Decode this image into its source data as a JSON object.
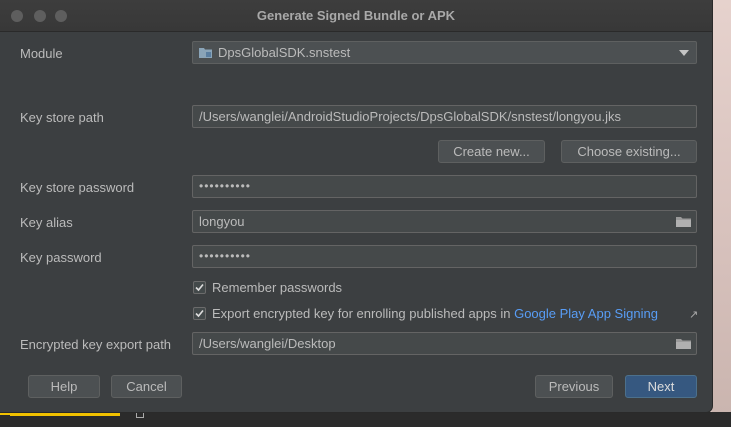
{
  "dialog": {
    "title": "Generate Signed Bundle or APK"
  },
  "module": {
    "label": "Module",
    "value": "DpsGlobalSDK.snstest"
  },
  "key_store_path": {
    "label": "Key store path",
    "value": "/Users/wanglei/AndroidStudioProjects/DpsGlobalSDK/snstest/longyou.jks"
  },
  "buttons": {
    "create_new": "Create new...",
    "choose_existing": "Choose existing...",
    "help": "Help",
    "cancel": "Cancel",
    "previous": "Previous",
    "next": "Next"
  },
  "key_store_password": {
    "label": "Key store password",
    "masked": "••••••••••"
  },
  "key_alias": {
    "label": "Key alias",
    "value": "longyou"
  },
  "key_password": {
    "label": "Key password",
    "masked": "••••••••••"
  },
  "remember_passwords": {
    "label": "Remember passwords",
    "checked": true
  },
  "export_encrypted": {
    "label": "Export encrypted key for enrolling published apps in",
    "link": "Google Play App Signing",
    "link_icon": "↗",
    "checked": true
  },
  "encrypted_export_path": {
    "label": "Encrypted key export path",
    "value": "/Users/wanglei/Desktop"
  },
  "colors": {
    "dialog_bg": "#3c3f41",
    "primary_button": "#365880",
    "link": "#589df6"
  }
}
